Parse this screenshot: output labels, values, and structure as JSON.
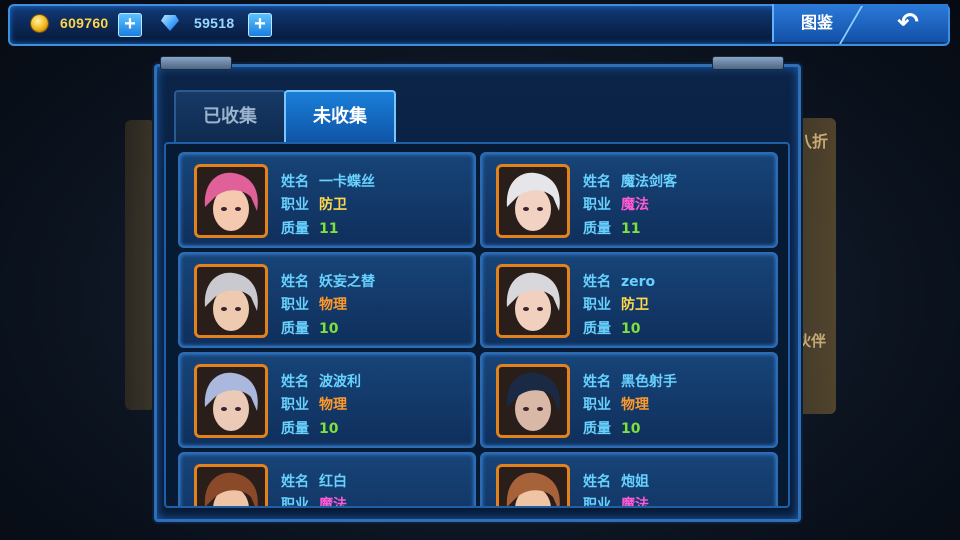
{
  "resources": {
    "gold": "609760",
    "gems": "59518"
  },
  "header": {
    "codex_label": "图鉴",
    "back_icon": "↶"
  },
  "side": {
    "right_top": "八折",
    "right_mid": "伙伴"
  },
  "tabs": [
    {
      "label": "已收集",
      "active": false
    },
    {
      "label": "未收集",
      "active": true
    }
  ],
  "labels": {
    "name": "姓名",
    "job": "职业",
    "quality": "质量"
  },
  "heroes": [
    {
      "name": "一卡蝶丝",
      "job": "防卫",
      "job_color": "#ffd94a",
      "quality": "11",
      "hair": "#e0609a",
      "skin": "#f4c9b0"
    },
    {
      "name": "魔法剑客",
      "job": "魔法",
      "job_color": "#ff5ad6",
      "quality": "11",
      "hair": "#e6e6ea",
      "skin": "#f2d2c2"
    },
    {
      "name": "妖妄之替",
      "job": "物理",
      "job_color": "#ff9a2a",
      "quality": "10",
      "hair": "#c9c9cf",
      "skin": "#eecab0"
    },
    {
      "name": "zero",
      "job": "防卫",
      "job_color": "#ffd94a",
      "quality": "10",
      "hair": "#d8d8dc",
      "skin": "#f1d0c0"
    },
    {
      "name": "波波利",
      "job": "物理",
      "job_color": "#ff9a2a",
      "quality": "10",
      "hair": "#a9b8dc",
      "skin": "#eccab8"
    },
    {
      "name": "黑色射手",
      "job": "物理",
      "job_color": "#ff9a2a",
      "quality": "10",
      "hair": "#1b2a44",
      "skin": "#d9b8a8"
    },
    {
      "name": "红白",
      "job": "魔法",
      "job_color": "#ff5ad6",
      "quality": "",
      "hair": "#8a4a2a",
      "skin": "#eec4a4"
    },
    {
      "name": "炮姐",
      "job": "魔法",
      "job_color": "#ff5ad6",
      "quality": "",
      "hair": "#a7623a",
      "skin": "#eec4a4"
    }
  ]
}
